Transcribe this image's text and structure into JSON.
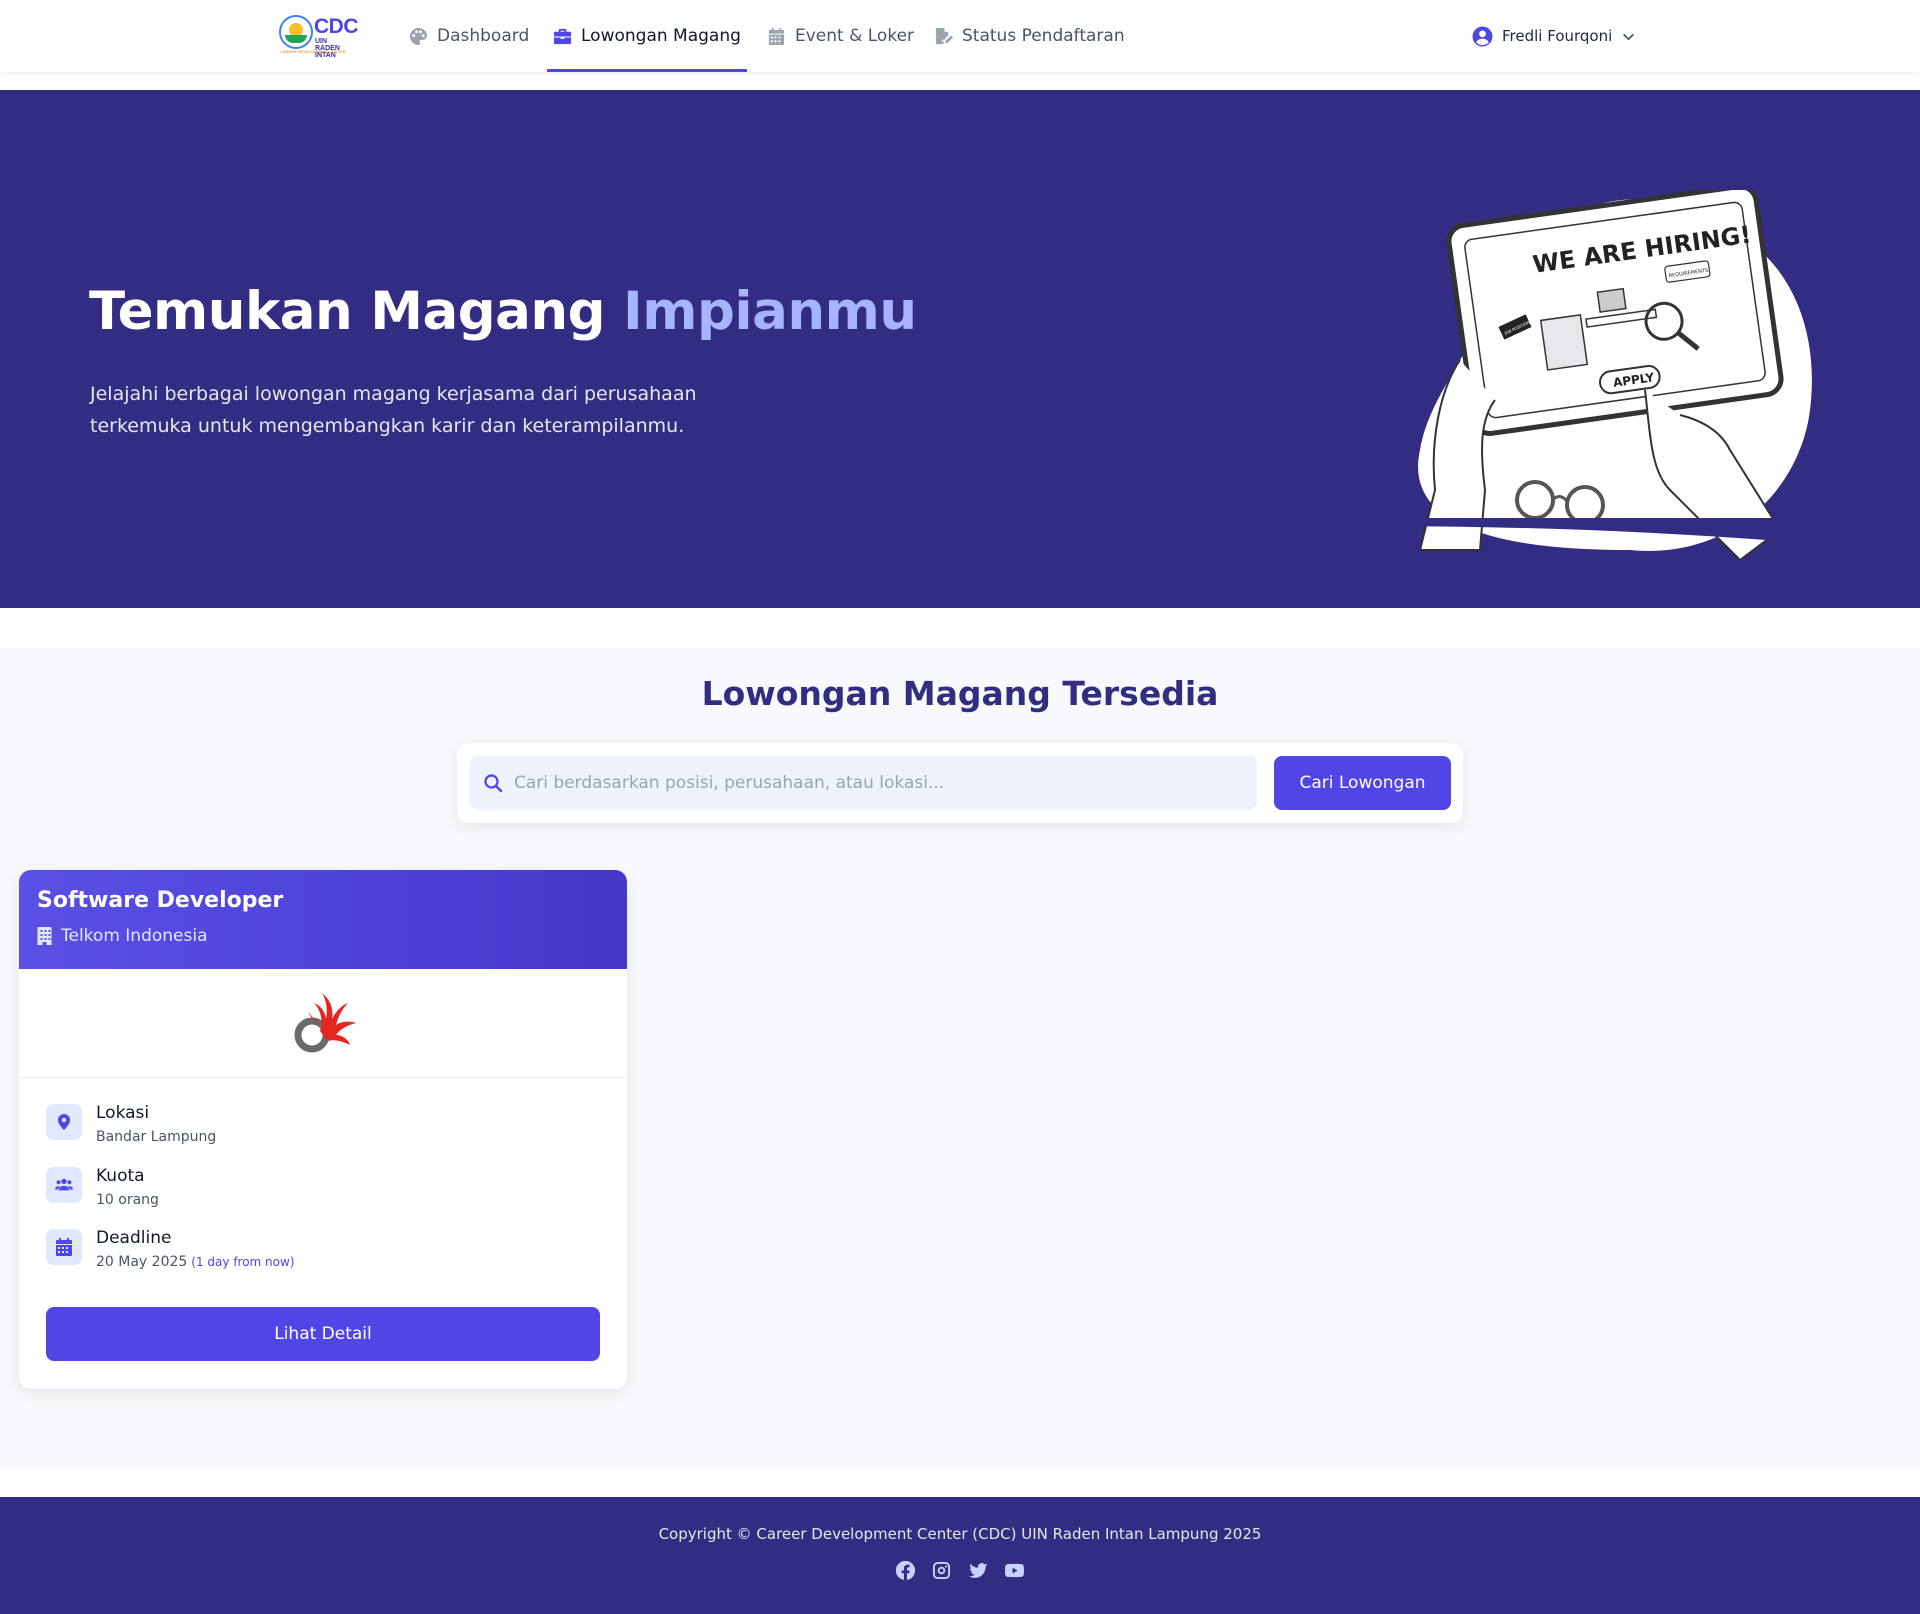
{
  "app": {
    "logo_abbr": "CDC",
    "logo_sub": [
      "UIN",
      "RADEN INTAN"
    ],
    "logo_tagline": "CAREER DEVELOPMENT CENTER"
  },
  "nav": {
    "items": [
      {
        "label": "Dashboard",
        "icon": "palette-icon",
        "active": false
      },
      {
        "label": "Lowongan Magang",
        "icon": "briefcase-icon",
        "active": true
      },
      {
        "label": "Event & Loker",
        "icon": "calendar-icon",
        "active": false
      },
      {
        "label": "Status Pendaftaran",
        "icon": "file-signature-icon",
        "active": false
      }
    ],
    "user_name": "Fredli Fourqoni"
  },
  "hero": {
    "title_main": "Temukan Magang",
    "title_highlight": "Impianmu",
    "description": "Jelajahi berbagai lowongan magang kerjasama dari perusahaan terkemuka untuk mengembangkan karir dan keterampilanmu.",
    "illustration_text": {
      "headline": "WE ARE HIRING!",
      "bubble": "REQUIREMENTS",
      "sign": "JOB POSITION",
      "button": "APPLY"
    }
  },
  "listing": {
    "section_title": "Lowongan Magang Tersedia",
    "search_placeholder": "Cari berdasarkan posisi, perusahaan, atau lokasi...",
    "search_value": "",
    "search_button": "Cari Lowongan"
  },
  "jobs": [
    {
      "title": "Software Developer",
      "company": "Telkom Indonesia",
      "location_label": "Lokasi",
      "location": "Bandar Lampung",
      "quota_label": "Kuota",
      "quota": "10 orang",
      "deadline_label": "Deadline",
      "deadline": "20 May 2025",
      "deadline_relative": "(1 day from now)",
      "button": "Lihat Detail"
    }
  ],
  "footer": {
    "copyright": "Copyright © Career Development Center (CDC) UIN Raden Intan Lampung 2025",
    "socials": [
      "facebook-icon",
      "instagram-icon",
      "twitter-icon",
      "youtube-icon"
    ]
  },
  "colors": {
    "primary": "#4f46e5",
    "hero_bg": "#322d82",
    "highlight": "#a5b4fc",
    "section_bg": "#f8f9fc"
  }
}
